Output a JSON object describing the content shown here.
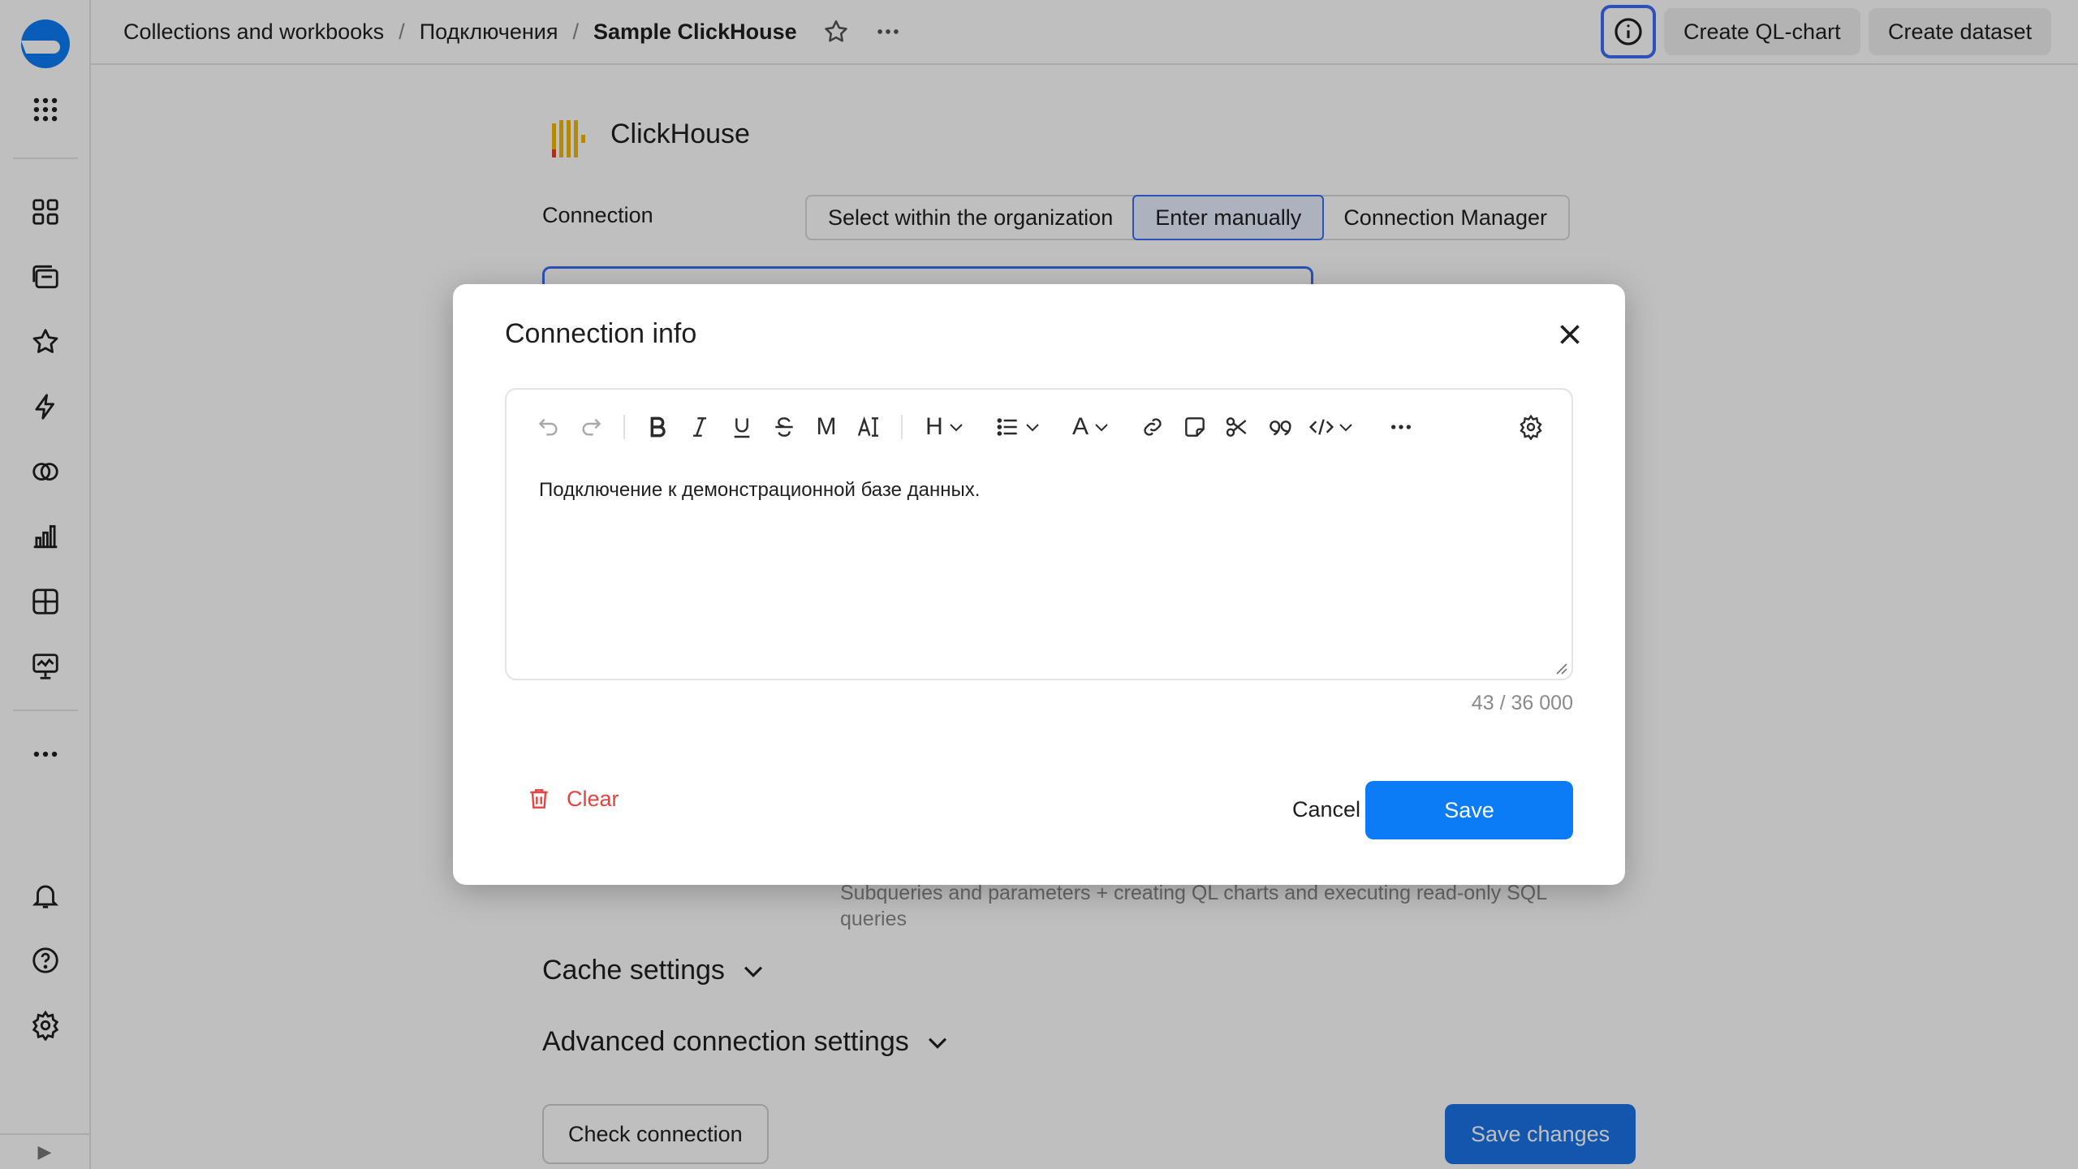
{
  "header": {
    "breadcrumbs": [
      "Collections and workbooks",
      "Подключения",
      "Sample ClickHouse"
    ],
    "buttons": {
      "create_ql_chart": "Create QL-chart",
      "create_dataset": "Create dataset"
    }
  },
  "sidebar": {
    "items": [
      "dashboards-icon",
      "collections-icon",
      "favorites-icon",
      "connections-icon",
      "datasets-icon",
      "charts-icon",
      "workbooks-icon",
      "reports-icon",
      "more-icon"
    ],
    "bottom": [
      "notifications-icon",
      "help-icon",
      "settings-icon"
    ],
    "collapse_glyph": "▶"
  },
  "page": {
    "title": "ClickHouse",
    "connection_label": "Connection",
    "connection_modes": [
      "Select within the organization",
      "Enter manually",
      "Connection Manager"
    ],
    "selected_mode": "Enter manually",
    "access_description": "Subqueries and parameters + creating QL charts and executing read-only SQL queries",
    "sections": {
      "cache": "Cache settings",
      "advanced": "Advanced connection settings"
    },
    "check_connection": "Check connection",
    "save_changes": "Save changes"
  },
  "modal": {
    "title": "Connection info",
    "editor_text": "Подключение к демонстрационной базе данных.",
    "counter": "43 / 36 000",
    "clear": "Clear",
    "cancel": "Cancel",
    "save": "Save",
    "toolbar_glyphs": {
      "mono": "M",
      "heading": "H",
      "color": "A"
    }
  },
  "colors": {
    "accent": "#0b7cf6",
    "danger": "#e6423f",
    "focus": "#3b6ef5",
    "clickhouse": "#f2b705"
  }
}
